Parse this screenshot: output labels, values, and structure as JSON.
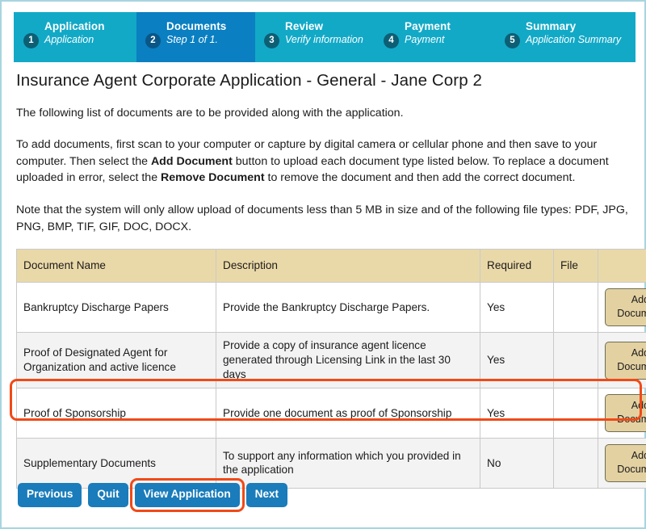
{
  "colors": {
    "stepbar_bg": "#12a9c7",
    "stepbar_active": "#0a7fc2",
    "step_num_circle": "#0d5f74",
    "table_header_bg": "#ead9a8",
    "add_button_bg": "#e3d1a2",
    "nav_button_bg": "#1a7cba",
    "highlight_ring": "#f04a18",
    "page_border": "#a8d4e0",
    "row_alt_bg": "#f3f3f3"
  },
  "steps": [
    {
      "number": "1",
      "title": "Application",
      "subtitle": "Application",
      "active": false
    },
    {
      "number": "2",
      "title": "Documents",
      "subtitle": "Step 1 of 1.",
      "active": true
    },
    {
      "number": "3",
      "title": "Review",
      "subtitle": "Verify information",
      "active": false
    },
    {
      "number": "4",
      "title": "Payment",
      "subtitle": "Payment",
      "active": false
    },
    {
      "number": "5",
      "title": "Summary",
      "subtitle": "Application Summary",
      "active": false
    }
  ],
  "page": {
    "title": "Insurance Agent Corporate Application - General - Jane Corp 2",
    "intro": "The following list of documents are to be provided along with the application.",
    "instructions": {
      "part1": "To add documents, first scan to your computer or capture by digital camera or cellular phone and then save to your computer. Then select the ",
      "bold1": "Add Document",
      "part2": " button to upload each document type listed below. To replace a document uploaded in error, select the ",
      "bold2": "Remove Document",
      "part3": " to remove the document and then add the correct document."
    },
    "note": "Note that the system will only allow upload of documents less than 5 MB in size and of the following file types: PDF, JPG, PNG, BMP, TIF, GIF, DOC, DOCX."
  },
  "table": {
    "headers": {
      "name": "Document Name",
      "description": "Description",
      "required": "Required",
      "file": "File",
      "action": ""
    },
    "rows": [
      {
        "name": "Bankruptcy Discharge Papers",
        "description": "Provide the Bankruptcy Discharge Papers.",
        "required": "Yes",
        "file": "",
        "action_label": "Add Document"
      },
      {
        "name": "Proof of Designated Agent for Organization and active licence",
        "description": "Provide a copy of insurance agent licence generated through Licensing Link in the last 30 days",
        "required": "Yes",
        "file": "",
        "action_label": "Add Document"
      },
      {
        "name": "Proof of Sponsorship",
        "description": "Provide one document as proof of Sponsorship",
        "required": "Yes",
        "file": "",
        "action_label": "Add Document"
      },
      {
        "name": "Supplementary Documents",
        "description": "To support any information which you provided in the application",
        "required": "No",
        "file": "",
        "action_label": "Add Document"
      }
    ]
  },
  "footer": {
    "previous": "Previous",
    "quit": "Quit",
    "view_application": "View Application",
    "next": "Next"
  }
}
